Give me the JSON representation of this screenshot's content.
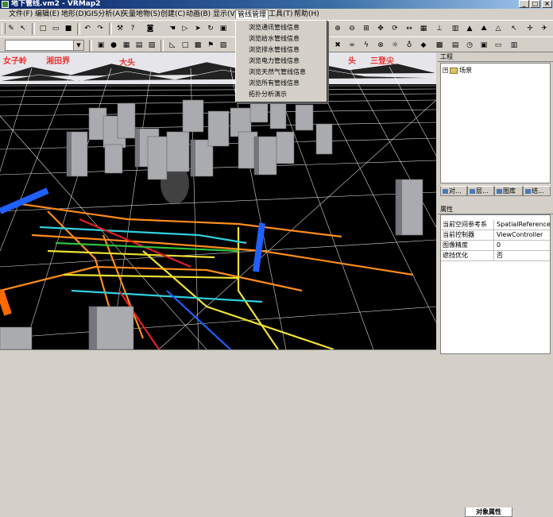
{
  "window": {
    "title": "地下管线.vm2 - VRMap2",
    "controls": [
      "_",
      "□",
      "×"
    ]
  },
  "menubar": {
    "items": [
      {
        "label": "文件(F)"
      },
      {
        "label": "编辑(E)"
      },
      {
        "label": "地形(D)"
      },
      {
        "label": "GIS分析(A)"
      },
      {
        "label": "矢量地物(S)"
      },
      {
        "label": "创建(C)"
      },
      {
        "label": "动画(B)"
      },
      {
        "label": "显示(V)"
      },
      {
        "label": "管线管理"
      },
      {
        "label": "工具(T)"
      },
      {
        "label": "帮助(H)"
      }
    ]
  },
  "dropdown": {
    "items": [
      {
        "label": "浏览通讯管线信息"
      },
      {
        "label": "浏览给水管线信息"
      },
      {
        "label": "浏览排水管线信息"
      },
      {
        "label": "浏览电力管线信息"
      },
      {
        "label": "浏览天然气管线信息"
      },
      {
        "label": "浏览所有管线信息"
      },
      {
        "label": "拓扑分析演示"
      }
    ]
  },
  "scene": {
    "sky_labels": [
      "女子岭",
      "湘田界",
      "大头",
      "头",
      "三登尖"
    ]
  },
  "project_panel": {
    "title": "工程",
    "tree_root": "场景"
  },
  "tabs": [
    {
      "label": "对..."
    },
    {
      "label": "层..."
    },
    {
      "label": "图库"
    },
    {
      "label": "结..."
    }
  ],
  "properties_panel": {
    "title": "属性",
    "rows": [
      {
        "key": "当前空间参考系",
        "value": "SpatialReference"
      },
      {
        "key": "当前控制器",
        "value": "ViewController"
      },
      {
        "key": "图像精度",
        "value": "0"
      },
      {
        "key": "遮挡优化",
        "value": "否"
      }
    ],
    "bottom_tab": "对象属性"
  },
  "colors": {
    "titlebar": "#0a246a",
    "pipe_orange": "#ff8c1a",
    "pipe_yellow": "#f0e030",
    "pipe_blue": "#2060ff",
    "pipe_cyan": "#30d0e0",
    "pipe_red": "#e02020",
    "pipe_green": "#30c040"
  }
}
